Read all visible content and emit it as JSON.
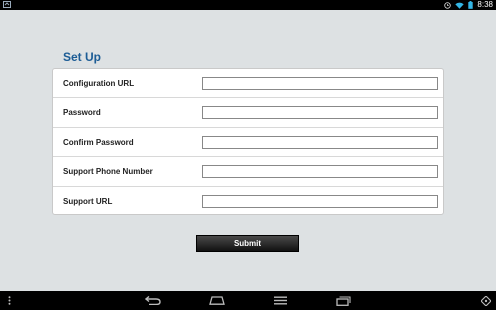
{
  "status_bar": {
    "time": "8:38",
    "icons": [
      "notification-icon",
      "alarm-icon",
      "wifi-icon",
      "battery-icon"
    ]
  },
  "setup": {
    "title": "Set Up",
    "fields": [
      {
        "label": "Configuration URL",
        "value": "",
        "placeholder": ""
      },
      {
        "label": "Password",
        "value": "",
        "placeholder": ""
      },
      {
        "label": "Confirm Password",
        "value": "",
        "placeholder": ""
      },
      {
        "label": "Support Phone Number",
        "value": "",
        "placeholder": ""
      },
      {
        "label": "Support URL",
        "value": "",
        "placeholder": ""
      }
    ],
    "submit_label": "Submit"
  },
  "nav_bar": {
    "icons": [
      "menu-dots-icon",
      "back-icon",
      "home-icon",
      "recent-apps-icon",
      "overflow-menu-icon",
      "screen-rotate-icon"
    ]
  },
  "colors": {
    "title": "#1c5c95",
    "background": "#dde1e3",
    "bars": "#000000"
  }
}
